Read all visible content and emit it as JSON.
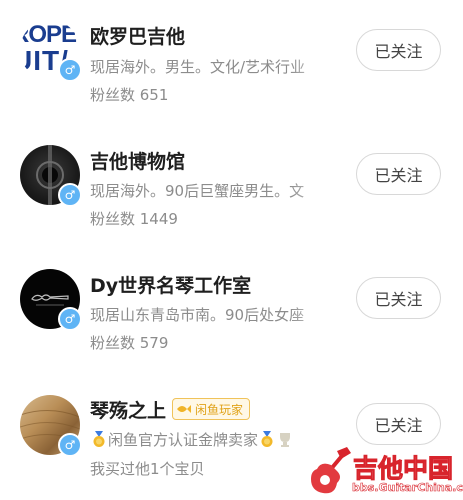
{
  "users": [
    {
      "name": "欧罗巴吉他",
      "avatar_text": [
        "ROPE",
        "UIT/"
      ],
      "gender": "♂",
      "description": "现居海外。男生。文化/艺术行业",
      "fans": "粉丝数 651",
      "follow_label": "已关注"
    },
    {
      "name": "吉他博物馆",
      "gender": "♂",
      "description": "现居海外。90后巨蟹座男生。文",
      "fans": "粉丝数 1449",
      "follow_label": "已关注"
    },
    {
      "name": "Dy世界名琴工作室",
      "gender": "♂",
      "description": "现居山东青岛市南。90后处女座",
      "fans": "粉丝数 579",
      "follow_label": "已关注"
    },
    {
      "name": "琴殇之上",
      "gender": "♂",
      "badge": "闲鱼玩家",
      "description": "闲鱼官方认证金牌卖家",
      "fans": "我买过他1个宝贝",
      "follow_label": "已关注"
    }
  ],
  "watermark": {
    "title": "吉他中国",
    "url": "bbs.GuitarChina.com"
  },
  "colors": {
    "gender_badge": "#5fb4f5",
    "badge_gold": "#e0a218",
    "watermark_red": "#d8242c"
  }
}
